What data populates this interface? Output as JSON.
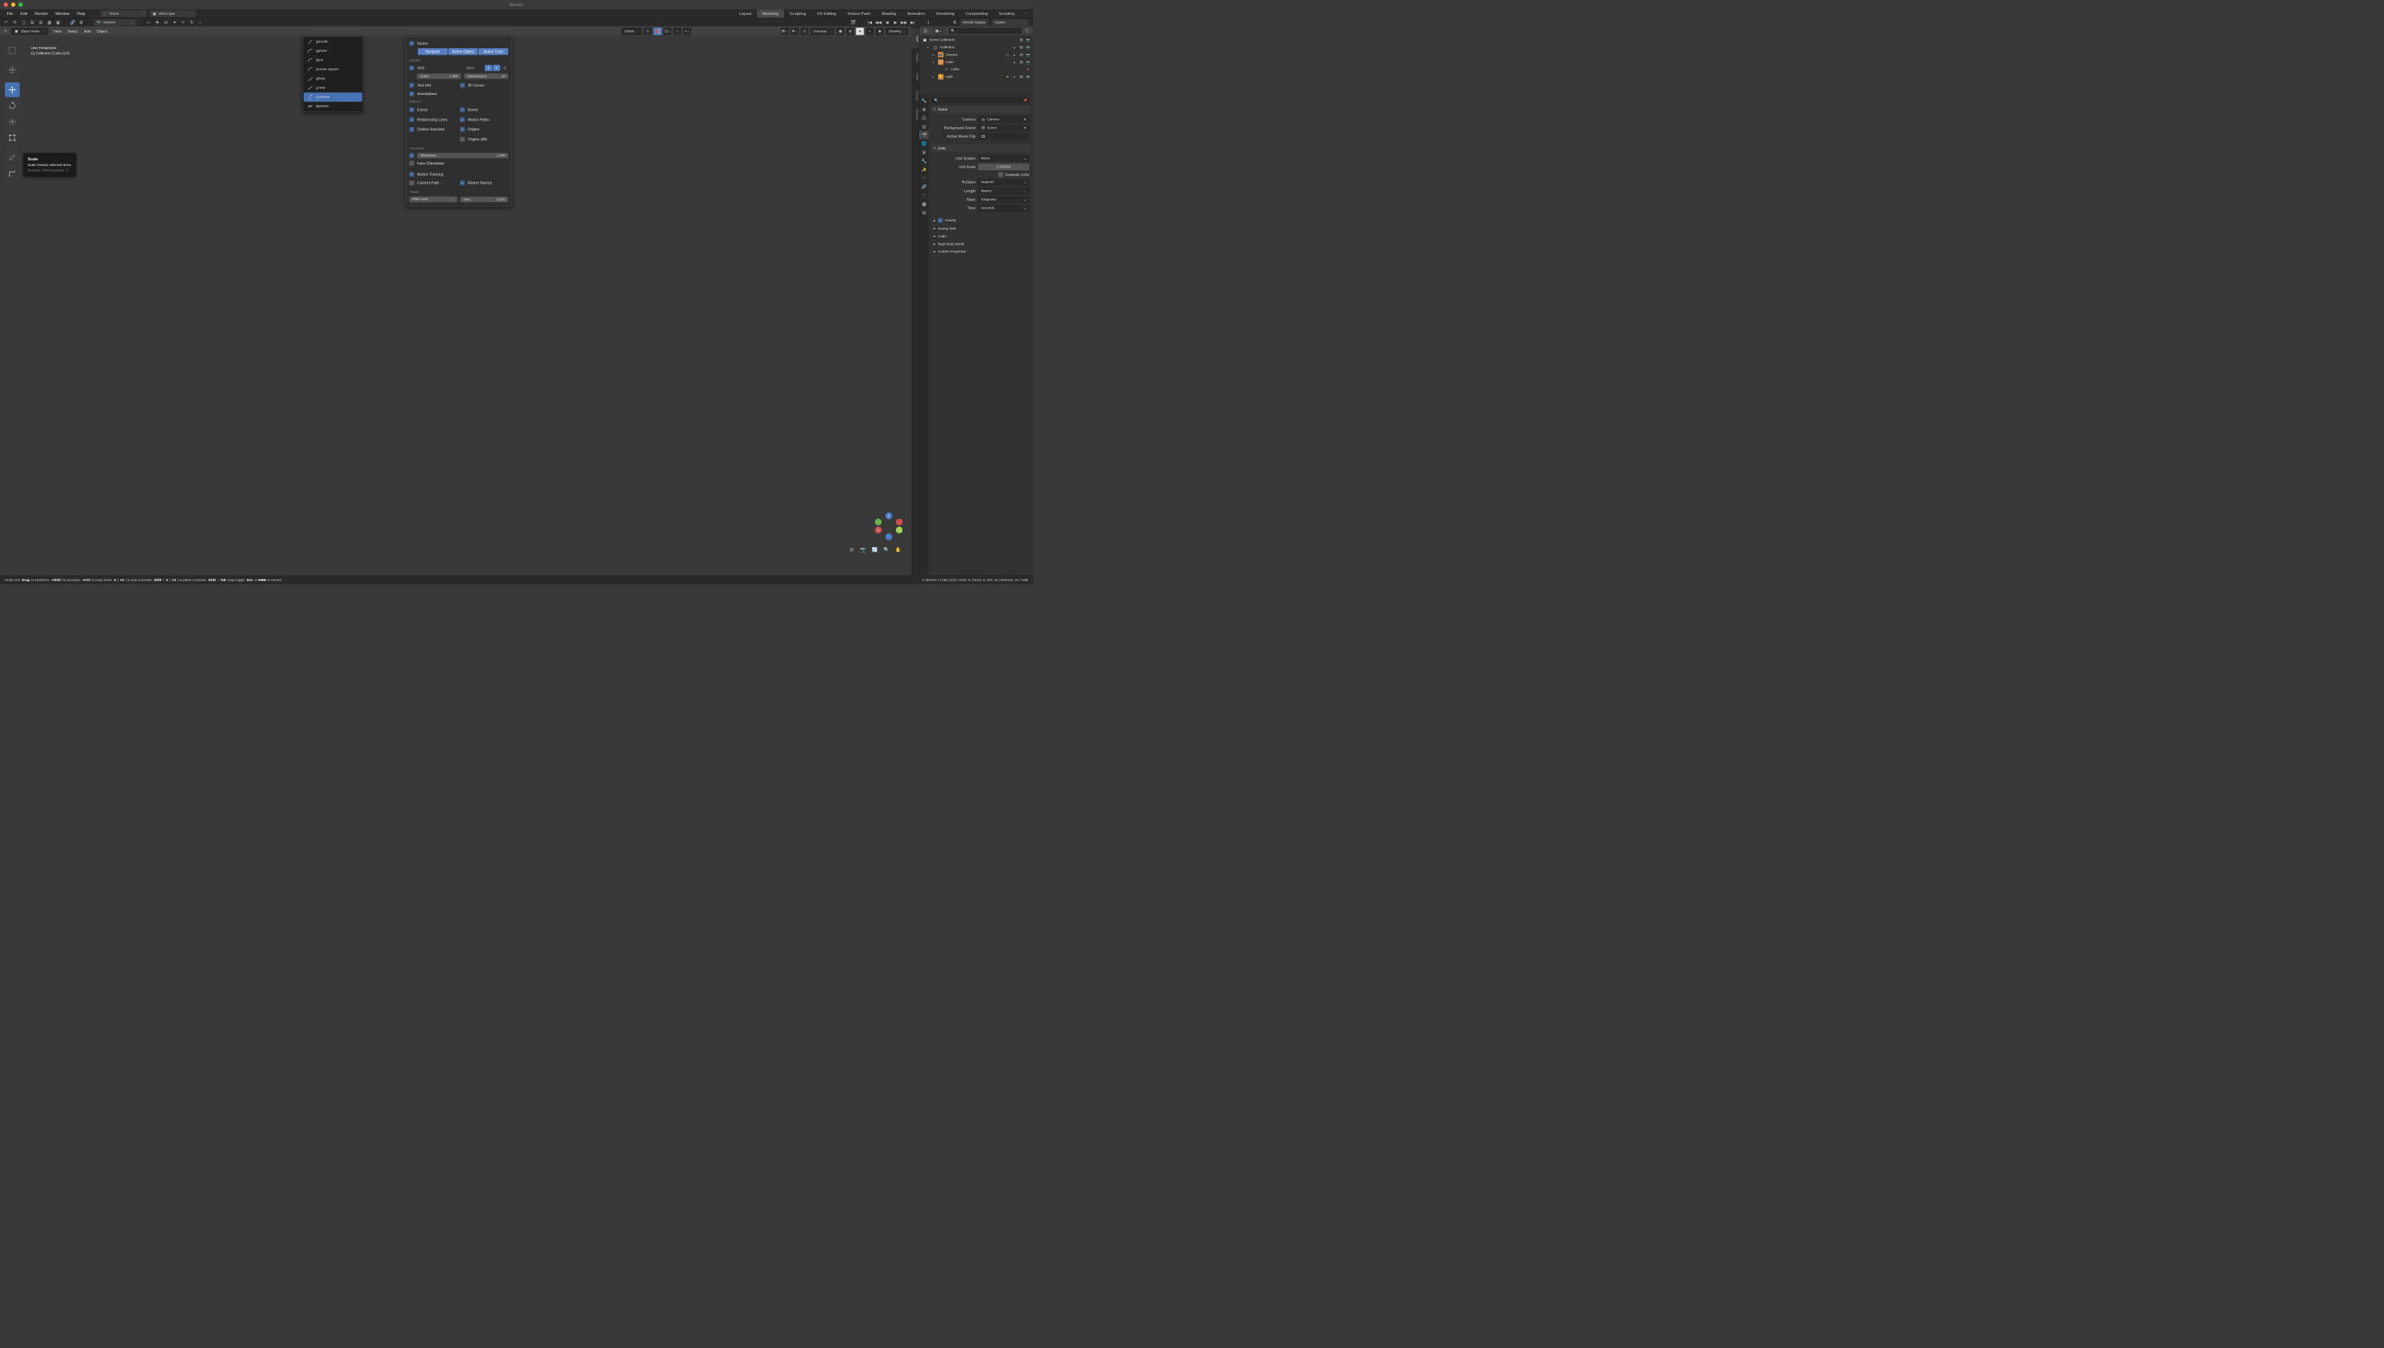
{
  "window": {
    "title": "Blender"
  },
  "menubar": {
    "items": [
      "File",
      "Edit",
      "Render",
      "Window",
      "Help"
    ]
  },
  "scene_sel": {
    "label": "Scene"
  },
  "layer_sel": {
    "label": "View Layer"
  },
  "workspaces": {
    "tabs": [
      "Layout",
      "Modeling",
      "Sculpting",
      "UV Editing",
      "Texture Paint",
      "Shading",
      "Animation",
      "Rendering",
      "Compositing",
      "Scripting"
    ],
    "active": "Modeling"
  },
  "toolbar2": {
    "camera": "Camera",
    "render_engine_label": "Render Engine",
    "render_engine": "Cycles"
  },
  "viewport": {
    "mode": "Object Mode",
    "menus": [
      "View",
      "Select",
      "Add",
      "Object"
    ],
    "transform_orientation": "Global",
    "overlays_label": "Overlays",
    "shading_label": "Shading",
    "info_line1": "User Perspective",
    "info_line2": "(1) Collection | Cube (1/3)",
    "frame": "1"
  },
  "tooltip": {
    "title": "Scale",
    "desc": "Scale (resize) selected items.",
    "shortcut": "Shortcut: Shift Spacebar, S"
  },
  "falloff_menu": {
    "items": [
      "Smooth",
      "Sphere",
      "Root",
      "Inverse Square",
      "Sharp",
      "Linear",
      "Constant",
      "Random"
    ],
    "highlighted": "Constant"
  },
  "overlays": {
    "gizmo": "Gizmo",
    "navigate": "Navigate",
    "active_object": "Active Object",
    "active_tools": "Active Tools",
    "guides": "Guides",
    "grid": "Grid",
    "axes": "Axes",
    "ax_x": "X",
    "ax_y": "Y",
    "ax_z": "Z",
    "scale_label": "Scale:",
    "scale_val": "1.000",
    "subdiv_label": "Subdivisions:",
    "subdiv_val": "10",
    "text_info": "Text Info",
    "cursor3d": "3D Cursor",
    "annotations": "Annotations",
    "objects": "Objects",
    "extras": "Extras",
    "bones": "Bones",
    "relationship": "Relationship Lines",
    "motion_paths": "Motion Paths",
    "outline_sel": "Outline Selected",
    "origins": "Origins",
    "origins_all": "Origins (All)",
    "geometry": "Geometry",
    "wireframe": "Wireframe:",
    "wireframe_val": "1.000",
    "face_orient": "Face Orientation",
    "motion_tracking": "Motion Tracking",
    "camera_path": "Camera Path",
    "marker_names": "Marker Names",
    "tracks": "Tracks",
    "plain_axes": "Plain Axes",
    "size_label": "Size:",
    "size_val": "0.200"
  },
  "outliner": {
    "root": "Scene Collection",
    "collection": "Collection",
    "camera": "Camera",
    "cube": "Cube",
    "cube2": "Cube",
    "light": "Light"
  },
  "props": {
    "scene": "Scene",
    "camera_label": "Camera",
    "camera_val": "Camera",
    "bg_scene_label": "Background Scene",
    "bg_scene_val": "Scene",
    "movie_clip_label": "Active Movie Clip",
    "units": "Units",
    "unit_system_label": "Unit System",
    "unit_system_val": "Metric",
    "unit_scale_label": "Unit Scale",
    "unit_scale_val": "1.000000",
    "separate_units": "Separate Units",
    "rotation_label": "Rotation",
    "rotation_val": "Degrees",
    "length_label": "Length",
    "length_val": "Meters",
    "mass_label": "Mass",
    "mass_val": "Kilograms",
    "time_label": "Time",
    "time_val": "Seconds",
    "gravity": "Gravity",
    "keying": "Keying Sets",
    "audio": "Audio",
    "rigid": "Rigid Body World",
    "custom": "Custom Properties"
  },
  "side_tabs": [
    "Tool",
    "Redo",
    "View",
    "Create",
    "Display"
  ],
  "statusbar": {
    "left_parts": [
      {
        "t": "Scale tool: "
      },
      {
        "k": "Drag"
      },
      {
        "t": " to transform, "
      },
      {
        "k": "+Shift"
      },
      {
        "t": " for precision, "
      },
      {
        "k": "+Ctrl"
      },
      {
        "t": " to snap invert. "
      },
      {
        "k": "X"
      },
      {
        "t": "("
      },
      {
        "k": "YZ"
      },
      {
        "t": ") to axis constrain, "
      },
      {
        "k": "Shift"
      },
      {
        "t": "+"
      },
      {
        "k": "X"
      },
      {
        "t": "("
      },
      {
        "k": "YZ"
      },
      {
        "t": ") to plane constrain. "
      },
      {
        "k": "Shift"
      },
      {
        "t": "+"
      },
      {
        "k": "Tab"
      },
      {
        "t": " snap toggle. "
      },
      {
        "k": "Esc"
      },
      {
        "t": " or "
      },
      {
        "k": "RMB"
      },
      {
        "t": " to cancel."
      }
    ],
    "right": "Collection | Cube (1/3) | Verts: 8, Faces: 6, Tris: 12 | Memory: 42.7 MiB"
  }
}
